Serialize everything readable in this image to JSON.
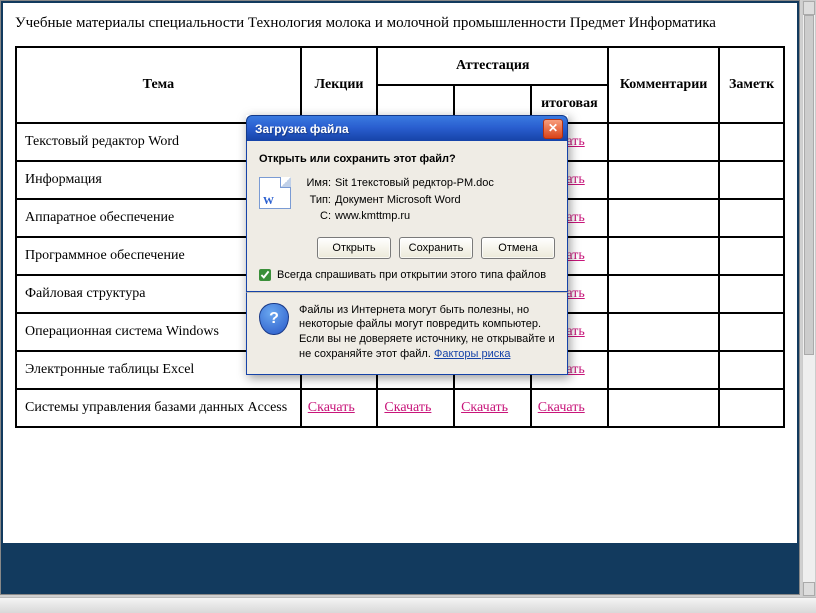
{
  "page": {
    "title": "Учебные материалы специальности Технология молока и молочной промышленности Предмет Информатика"
  },
  "table": {
    "headers": {
      "topic": "Тема",
      "lectures": "Лекции",
      "attestation": "Аттестация",
      "att_final": "итоговая",
      "comments": "Комментарии",
      "notes": "Заметк"
    },
    "download_label": "Скачать",
    "rows": [
      {
        "topic": "Текстовый редактор Word"
      },
      {
        "topic": "Информация"
      },
      {
        "topic": "Аппаратное обеспечение"
      },
      {
        "topic": "Программное обеспечение"
      },
      {
        "topic": "Файловая структура"
      },
      {
        "topic": "Операционная система Windows"
      },
      {
        "topic": "Электронные таблицы Excel"
      },
      {
        "topic": "Системы управления базами данных Access"
      }
    ]
  },
  "dialog": {
    "title": "Загрузка файла",
    "heading": "Открыть или сохранить этот файл?",
    "name_label": "Имя:",
    "name_value": "Sit 1текстовый редктор-PM.doc",
    "type_label": "Тип:",
    "type_value": "Документ Microsoft Word",
    "source_label": "С:",
    "source_value": "www.kmttmp.ru",
    "btn_open": "Открыть",
    "btn_save": "Сохранить",
    "btn_cancel": "Отмена",
    "checkbox_label": "Всегда спрашивать при открытии этого типа файлов",
    "footer_text": "Файлы из Интернета могут быть полезны, но некоторые файлы могут повредить компьютер. Если вы не доверяете источнику, не открывайте и не сохраняйте этот файл. ",
    "footer_link": "Факторы риска"
  }
}
